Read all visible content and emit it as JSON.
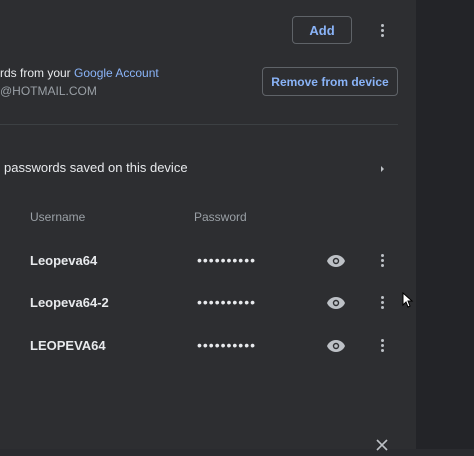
{
  "header": {
    "add_label": "Add",
    "menu_icon": "more-vert-icon"
  },
  "account": {
    "line1_prefix": "rds from your ",
    "line1_link": "Google Account",
    "email": "@HOTMAIL.COM",
    "remove_label": "Remove from device"
  },
  "device_section": {
    "label": "passwords saved on this device",
    "chevron_icon": "chevron-right-icon"
  },
  "table": {
    "col_username": "Username",
    "col_password": "Password",
    "rows": [
      {
        "username": "Leopeva64",
        "password": "••••••••••",
        "eye_icon": "eye-icon",
        "menu_icon": "more-vert-icon"
      },
      {
        "username": "Leopeva64-2",
        "password": "••••••••••",
        "eye_icon": "eye-icon",
        "menu_icon": "more-vert-icon"
      },
      {
        "username": "LEOPEVA64",
        "password": "••••••••••",
        "eye_icon": "eye-icon",
        "menu_icon": "more-vert-icon"
      }
    ]
  },
  "footer": {
    "close_icon": "close-icon"
  },
  "colors": {
    "background": "#2d2e31",
    "accent": "#8ab4f8",
    "text": "#e8eaed",
    "muted": "#9aa0a6"
  }
}
